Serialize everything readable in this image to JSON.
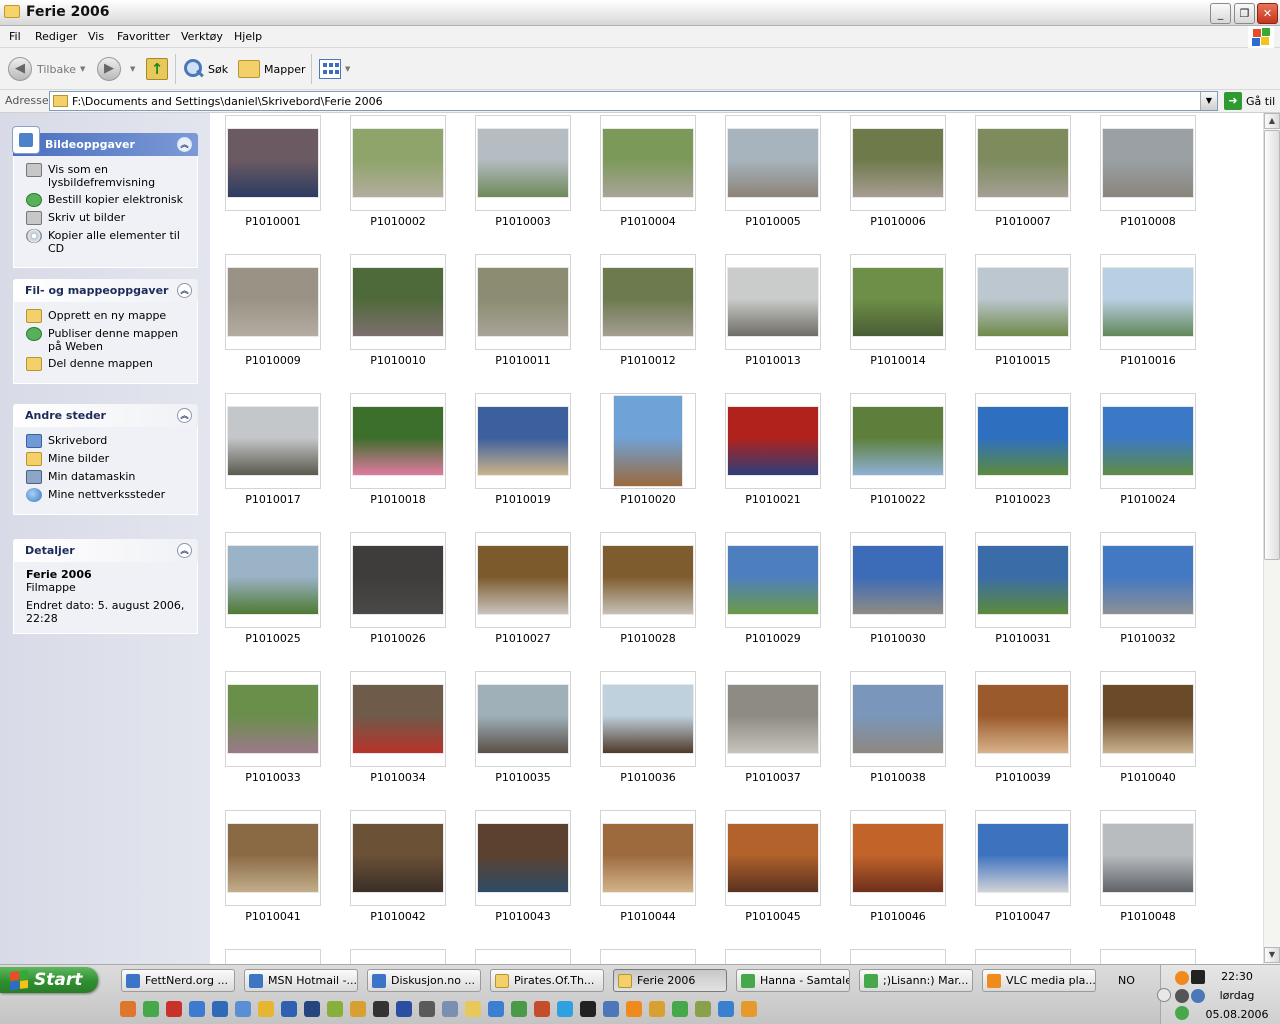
{
  "window": {
    "title": "Ferie 2006"
  },
  "menu": [
    "Fil",
    "Rediger",
    "Vis",
    "Favoritter",
    "Verktøy",
    "Hjelp"
  ],
  "toolbar": {
    "back": "Tilbake",
    "search": "Søk",
    "folders": "Mapper"
  },
  "address": {
    "label": "Adresse",
    "path": "F:\\Documents and Settings\\daniel\\Skrivebord\\Ferie 2006",
    "go": "Gå til"
  },
  "left": {
    "picture_tasks": {
      "title": "Bildeoppgaver",
      "items": [
        "Vis som en lysbildefremvisning",
        "Bestill kopier elektronisk",
        "Skriv ut bilder",
        "Kopier alle elementer til CD"
      ]
    },
    "file_tasks": {
      "title": "Fil- og mappeoppgaver",
      "items": [
        "Opprett en ny mappe",
        "Publiser denne mappen på Weben",
        "Del denne mappen"
      ]
    },
    "other_places": {
      "title": "Andre steder",
      "items": [
        "Skrivebord",
        "Mine bilder",
        "Min datamaskin",
        "Mine nettverkssteder"
      ]
    },
    "details": {
      "title": "Detaljer",
      "name": "Ferie 2006",
      "type": "Filmappe",
      "modified": "Endret dato: 5. august 2006, 22:28"
    }
  },
  "thumbnails": [
    {
      "name": "P1010001",
      "c1": "#6b5a62",
      "c2": "#2d3c63"
    },
    {
      "name": "P1010002",
      "c1": "#8ea46a",
      "c2": "#b3ad9d"
    },
    {
      "name": "P1010003",
      "c1": "#b5bcc2",
      "c2": "#6e8a5a"
    },
    {
      "name": "P1010004",
      "c1": "#7b9a5a",
      "c2": "#a9a499"
    },
    {
      "name": "P1010005",
      "c1": "#a7b4bd",
      "c2": "#8c8378"
    },
    {
      "name": "P1010006",
      "c1": "#6f7a4b",
      "c2": "#a69d93"
    },
    {
      "name": "P1010007",
      "c1": "#7d8b5d",
      "c2": "#a59f95"
    },
    {
      "name": "P1010008",
      "c1": "#9aa0a4",
      "c2": "#8a857c"
    },
    {
      "name": "P1010009",
      "c1": "#9b9286",
      "c2": "#b4aca0"
    },
    {
      "name": "P1010010",
      "c1": "#4f6a3a",
      "c2": "#7c6f6e"
    },
    {
      "name": "P1010011",
      "c1": "#8b8c72",
      "c2": "#aaa398"
    },
    {
      "name": "P1010012",
      "c1": "#6c7a4e",
      "c2": "#a59e93"
    },
    {
      "name": "P1010013",
      "c1": "#c9ccca",
      "c2": "#6f6d66"
    },
    {
      "name": "P1010014",
      "c1": "#6e8f47",
      "c2": "#4a5d36"
    },
    {
      "name": "P1010015",
      "c1": "#bcc7cf",
      "c2": "#6f8a4a"
    },
    {
      "name": "P1010016",
      "c1": "#b9cfe3",
      "c2": "#62885a"
    },
    {
      "name": "P1010017",
      "c1": "#c4c7ca",
      "c2": "#5b5a4e"
    },
    {
      "name": "P1010018",
      "c1": "#3c6e2c",
      "c2": "#e07aa0"
    },
    {
      "name": "P1010019",
      "c1": "#3c5f9e",
      "c2": "#cbb58a"
    },
    {
      "name": "P1010020",
      "c1": "#6fa3d8",
      "c2": "#9a6a3e"
    },
    {
      "name": "P1010021",
      "c1": "#b2221c",
      "c2": "#2c3e7a"
    },
    {
      "name": "P1010022",
      "c1": "#5d7f3b",
      "c2": "#8fb0d5"
    },
    {
      "name": "P1010023",
      "c1": "#2f6fc0",
      "c2": "#5c8a3c"
    },
    {
      "name": "P1010024",
      "c1": "#3b79c6",
      "c2": "#5f8c44"
    },
    {
      "name": "P1010025",
      "c1": "#9bb3c7",
      "c2": "#4f7a33"
    },
    {
      "name": "P1010026",
      "c1": "#3e3d3c",
      "c2": "#4a4948"
    },
    {
      "name": "P1010027",
      "c1": "#7c5a2c",
      "c2": "#c9c4bd"
    },
    {
      "name": "P1010028",
      "c1": "#7e5c2e",
      "c2": "#c6c0b7"
    },
    {
      "name": "P1010029",
      "c1": "#4d7fbf",
      "c2": "#6c9a47"
    },
    {
      "name": "P1010030",
      "c1": "#3c6bb8",
      "c2": "#8f8b85"
    },
    {
      "name": "P1010031",
      "c1": "#3a6da8",
      "c2": "#5d8a3b"
    },
    {
      "name": "P1010032",
      "c1": "#4378c2",
      "c2": "#8d9095"
    },
    {
      "name": "P1010033",
      "c1": "#6a8f4b",
      "c2": "#9b7a8a"
    },
    {
      "name": "P1010034",
      "c1": "#6e5b49",
      "c2": "#b8332b"
    },
    {
      "name": "P1010035",
      "c1": "#9fb0b9",
      "c2": "#5b4f46"
    },
    {
      "name": "P1010036",
      "c1": "#bfd1dc",
      "c2": "#4f3a2b"
    },
    {
      "name": "P1010037",
      "c1": "#8e8b85",
      "c2": "#c7c3bd"
    },
    {
      "name": "P1010038",
      "c1": "#7a96ba",
      "c2": "#8d8880"
    },
    {
      "name": "P1010039",
      "c1": "#9a5a2c",
      "c2": "#d8b28b"
    },
    {
      "name": "P1010040",
      "c1": "#6b4a2a",
      "c2": "#c9b28c"
    },
    {
      "name": "P1010041",
      "c1": "#8a6a45",
      "c2": "#c2ad8a"
    },
    {
      "name": "P1010042",
      "c1": "#6b5136",
      "c2": "#3a2f28"
    },
    {
      "name": "P1010043",
      "c1": "#5c4130",
      "c2": "#2f4b66"
    },
    {
      "name": "P1010044",
      "c1": "#9c6a3d",
      "c2": "#d3b38a"
    },
    {
      "name": "P1010045",
      "c1": "#b2622a",
      "c2": "#5a3220"
    },
    {
      "name": "P1010046",
      "c1": "#c2642a",
      "c2": "#6e2f1b"
    },
    {
      "name": "P1010047",
      "c1": "#3d72bf",
      "c2": "#d0d3d6"
    },
    {
      "name": "P1010048",
      "c1": "#b9bcbf",
      "c2": "#5f6368"
    }
  ],
  "taskbar": {
    "start": "Start",
    "buttons": [
      "FettNerd.org ...",
      "MSN Hotmail -...",
      "Diskusjon.no ...",
      "Pirates.Of.Th...",
      "Ferie 2006",
      "Hanna - Samtale",
      ";)Lisann:) Mar...",
      "VLC media pla..."
    ],
    "lang": "NO",
    "time": "22:30",
    "day": "lørdag",
    "date": "05.08.2006"
  },
  "colors": {
    "taskpane_header": "#4a6fbf",
    "start_green": "#2f8f2f",
    "close_red": "#c2361c"
  }
}
